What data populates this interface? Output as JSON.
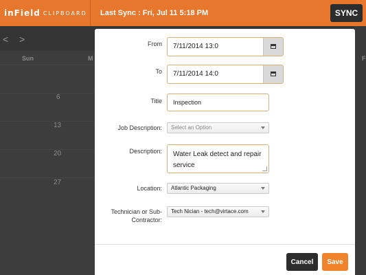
{
  "app": {
    "logo_main": "inField",
    "logo_sub": "CLIPBOARD",
    "last_sync": "Last Sync : Fri, Jul 11 5:18 PM",
    "sync_label": "SYNC",
    "brand_color": "#e8772e"
  },
  "calendar": {
    "prev_arrow": "<",
    "next_arrow": ">",
    "day_header_sun": "Sun",
    "day_header_mon": "M",
    "day_header_fri": "F",
    "days": [
      "6",
      "13",
      "20",
      "27"
    ]
  },
  "form": {
    "from_label": "From",
    "from_value": "7/11/2014 13:0",
    "to_label": "To",
    "to_value": "7/11/2014 14:0",
    "title_label": "Title",
    "title_value": "Inspection",
    "job_description_label": "Job Description:",
    "job_description_placeholder": "Select an Option",
    "description_label": "Description:",
    "description_value": "Water Leak detect and repair service",
    "location_label": "Location:",
    "location_value": "Atlantic Packaging",
    "technician_label": "Technician or Sub-Contractor:",
    "technician_value": "Tech Nician - tech@virtace.com",
    "icons": [
      "calendar-icon",
      "calendar-icon"
    ]
  },
  "actions": {
    "cancel_label": "Cancel",
    "save_label": "Save",
    "save_color": "#f0842d"
  }
}
